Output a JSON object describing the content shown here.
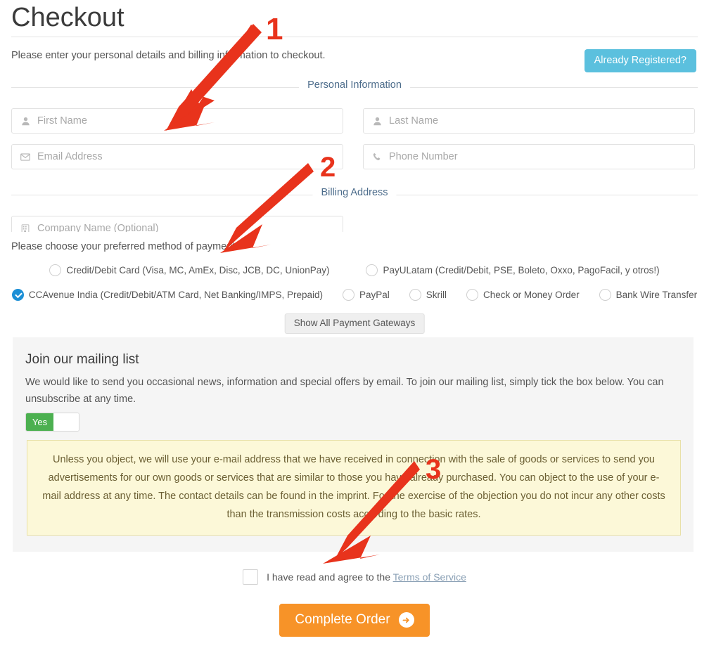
{
  "header": {
    "title": "Checkout",
    "intro": "Please enter your personal details and billing information to checkout.",
    "already_registered_label": "Already Registered?",
    "already_registered_color": "#5bc0de"
  },
  "sections": {
    "personal_information": "Personal Information",
    "billing_address": "Billing Address"
  },
  "fields": [
    {
      "name": "first-name",
      "placeholder": "First Name",
      "icon": "user-icon"
    },
    {
      "name": "last-name",
      "placeholder": "Last Name",
      "icon": "user-icon"
    },
    {
      "name": "email",
      "placeholder": "Email Address",
      "icon": "envelope-icon"
    },
    {
      "name": "phone",
      "placeholder": "Phone Number",
      "icon": "phone-icon"
    },
    {
      "name": "company-name",
      "placeholder": "Company Name (Optional)",
      "icon": "building-icon"
    }
  ],
  "payment": {
    "note": "Please choose your preferred method of payment.",
    "options_row1": [
      {
        "label": "Credit/Debit Card (Visa, MC, AmEx, Disc, JCB, DC, UnionPay)",
        "selected": false
      },
      {
        "label": "PayULatam (Credit/Debit, PSE, Boleto, Oxxo, PagoFacil, y otros!)",
        "selected": false
      }
    ],
    "options_row2": [
      {
        "label": "CCAvenue India (Credit/Debit/ATM Card, Net Banking/IMPS, Prepaid)",
        "selected": true
      },
      {
        "label": "PayPal",
        "selected": false
      },
      {
        "label": "Skrill",
        "selected": false
      },
      {
        "label": "Check or Money Order",
        "selected": false
      },
      {
        "label": "Bank Wire Transfer",
        "selected": false
      }
    ],
    "selected_accent": "#1c8fd6",
    "show_all_label": "Show All Payment Gateways"
  },
  "mailing_list": {
    "title": "Join our mailing list",
    "body": "We would like to send you occasional news, information and special offers by email. To join our mailing list, simply tick the box below. You can unsubscribe at any time.",
    "toggle_on_label": "Yes",
    "toggle_state": "on",
    "toggle_on_color": "#4cb050",
    "notice": "Unless you object, we will use your e-mail address that we have received in connection with the sale of goods or services to send you advertisements for our own goods or services that are similar to those you have already purchased. You can object to the use of your e-mail address at any time. The contact details can be found in the imprint. For the exercise of the objection you do not incur any other costs than the transmission costs according to the basic rates.",
    "notice_bg": "#fcf8d8",
    "panel_bg": "#f5f5f5"
  },
  "terms": {
    "label_prefix": "I have read and agree to the ",
    "link_label": "Terms of Service",
    "checked": false
  },
  "submit": {
    "label": "Complete Order",
    "color": "#f79328",
    "icon": "arrow-right-circle-icon"
  },
  "annotations": [
    {
      "number": "1",
      "color": "#e8331c"
    },
    {
      "number": "2",
      "color": "#e8331c"
    },
    {
      "number": "3",
      "color": "#e8331c"
    }
  ]
}
